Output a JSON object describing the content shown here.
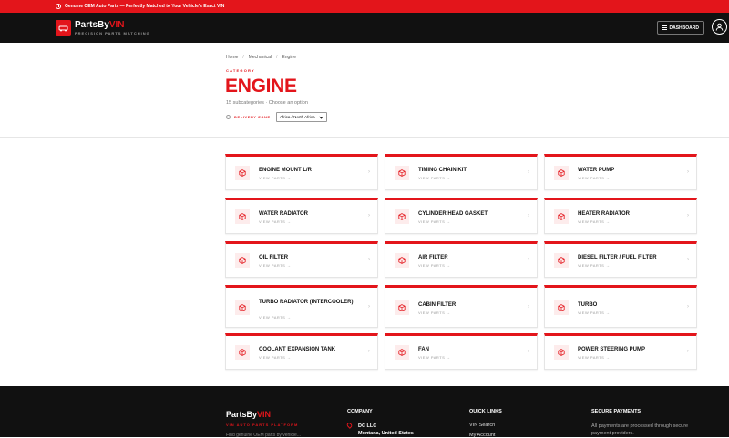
{
  "topbar": {
    "text": "Genuine OEM Auto Parts — Perfectly Matched to Your Vehicle's Exact VIN"
  },
  "header": {
    "brand_a": "PartsBy",
    "brand_b": "VIN",
    "tagline": "PRECISION PARTS MATCHING",
    "dashboard_label": "DASHBOARD"
  },
  "breadcrumb": {
    "home": "Home",
    "sep": "/",
    "mechanical": "Mechanical",
    "current": "Engine"
  },
  "page": {
    "category_label": "CATEGORY",
    "title": "ENGINE",
    "subtitle": "15 subcategories · Choose an option",
    "zone_label": "DELIVERY ZONE",
    "zone_value": "Africa / North Africa"
  },
  "cards": [
    {
      "name": "ENGINE MOUNT L/R",
      "cta": "VIEW PARTS →"
    },
    {
      "name": "TIMING CHAIN KIT",
      "cta": "VIEW PARTS →"
    },
    {
      "name": "WATER PUMP",
      "cta": "VIEW PARTS →"
    },
    {
      "name": "WATER RADIATOR",
      "cta": "VIEW PARTS →"
    },
    {
      "name": "CYLINDER HEAD GASKET",
      "cta": "VIEW PARTS →"
    },
    {
      "name": "HEATER RADIATOR",
      "cta": "VIEW PARTS →"
    },
    {
      "name": "OIL FILTER",
      "cta": "VIEW PARTS →"
    },
    {
      "name": "AIR FILTER",
      "cta": "VIEW PARTS →"
    },
    {
      "name": "DIESEL FILTER / FUEL FILTER",
      "cta": "VIEW PARTS →"
    },
    {
      "name": "TURBO RADIATOR (INTERCOOLER)",
      "cta": "VIEW PARTS →"
    },
    {
      "name": "CABIN FILTER",
      "cta": "VIEW PARTS →"
    },
    {
      "name": "TURBO",
      "cta": "VIEW PARTS →"
    },
    {
      "name": "COOLANT EXPANSION TANK",
      "cta": "VIEW PARTS →"
    },
    {
      "name": "FAN",
      "cta": "VIEW PARTS →"
    },
    {
      "name": "POWER STEERING PUMP",
      "cta": "VIEW PARTS →"
    }
  ],
  "footer": {
    "brand_a": "PartsBy",
    "brand_b": "VIN",
    "tagline": "VIN AUTO PARTS PLATFORM",
    "desc": "Find genuine OEM parts by vehicle...",
    "company_heading": "COMPANY",
    "company_name": "DC LLC",
    "company_location": "Montana, United States",
    "links_heading": "QUICK LINKS",
    "link_vin_search": "VIN Search",
    "link_my_account": "My Account",
    "payments_heading": "SECURE PAYMENTS",
    "payments_text": "All payments are processed through secure payment providers."
  },
  "colors": {
    "accent": "#e3151b",
    "header_bg": "#111111"
  }
}
